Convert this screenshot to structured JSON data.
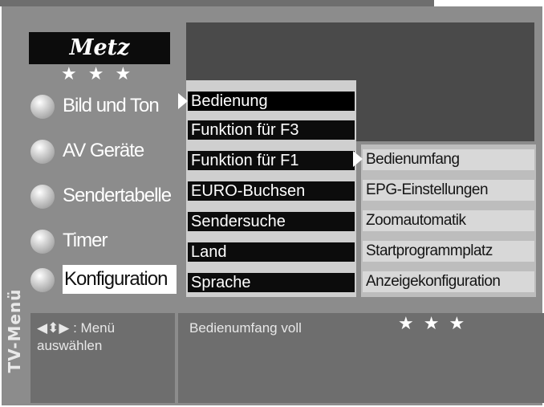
{
  "window": {
    "title": "TV-Menü"
  },
  "logo": {
    "text": "Metz",
    "stars": "★★★"
  },
  "main_menu": [
    {
      "label": "Bild und Ton",
      "selected": false
    },
    {
      "label": "AV Geräte",
      "selected": false
    },
    {
      "label": "Sendertabelle",
      "selected": false
    },
    {
      "label": "Timer",
      "selected": false
    },
    {
      "label": "Konfiguration",
      "selected": true
    }
  ],
  "submenu": [
    {
      "label": "Bedienung",
      "selected": true
    },
    {
      "label": "Funktion für F3",
      "selected": false
    },
    {
      "label": "Funktion für F1",
      "selected": false
    },
    {
      "label": "EURO-Buchsen",
      "selected": false
    },
    {
      "label": "Sendersuche",
      "selected": false
    },
    {
      "label": "Land",
      "selected": false
    },
    {
      "label": "Sprache",
      "selected": false
    }
  ],
  "submenu2": [
    {
      "label": "Bedienumfang",
      "selected": true
    },
    {
      "label": "EPG-Einstellungen",
      "selected": false
    },
    {
      "label": "Zoomautomatik",
      "selected": false
    },
    {
      "label": "Startprogrammplatz",
      "selected": false
    },
    {
      "label": "Anzeigekonfiguration",
      "selected": false
    }
  ],
  "help": {
    "line1": "◀⬍▶ : Menü",
    "line2": "auswählen"
  },
  "info": {
    "text": "Bedienumfang voll",
    "stars": "★★★"
  }
}
